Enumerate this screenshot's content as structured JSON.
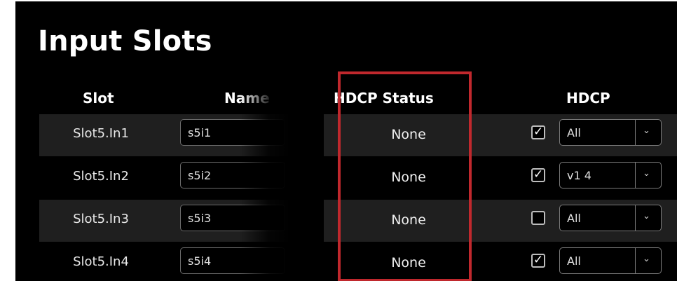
{
  "title": "Input Slots",
  "columns": {
    "slot": "Slot",
    "name": "Name",
    "hdcp_status": "HDCP Status",
    "hdcp": "HDCP"
  },
  "rows": [
    {
      "slot": "Slot5.In1",
      "name": "s5i1",
      "hdcp_status": "None",
      "hdcp_enabled": true,
      "hdcp_select": "All"
    },
    {
      "slot": "Slot5.In2",
      "name": "s5i2",
      "hdcp_status": "None",
      "hdcp_enabled": true,
      "hdcp_select": "v1 4"
    },
    {
      "slot": "Slot5.In3",
      "name": "s5i3",
      "hdcp_status": "None",
      "hdcp_enabled": false,
      "hdcp_select": "All"
    },
    {
      "slot": "Slot5.In4",
      "name": "s5i4",
      "hdcp_status": "None",
      "hdcp_enabled": true,
      "hdcp_select": "All"
    }
  ],
  "icons": {
    "checkbox_checked": "checkmark-icon",
    "select_arrow": "chevron-down-icon"
  },
  "colors": {
    "background": "#000000",
    "row_shade": "#1f1f1f",
    "highlight": "#c0282d"
  }
}
